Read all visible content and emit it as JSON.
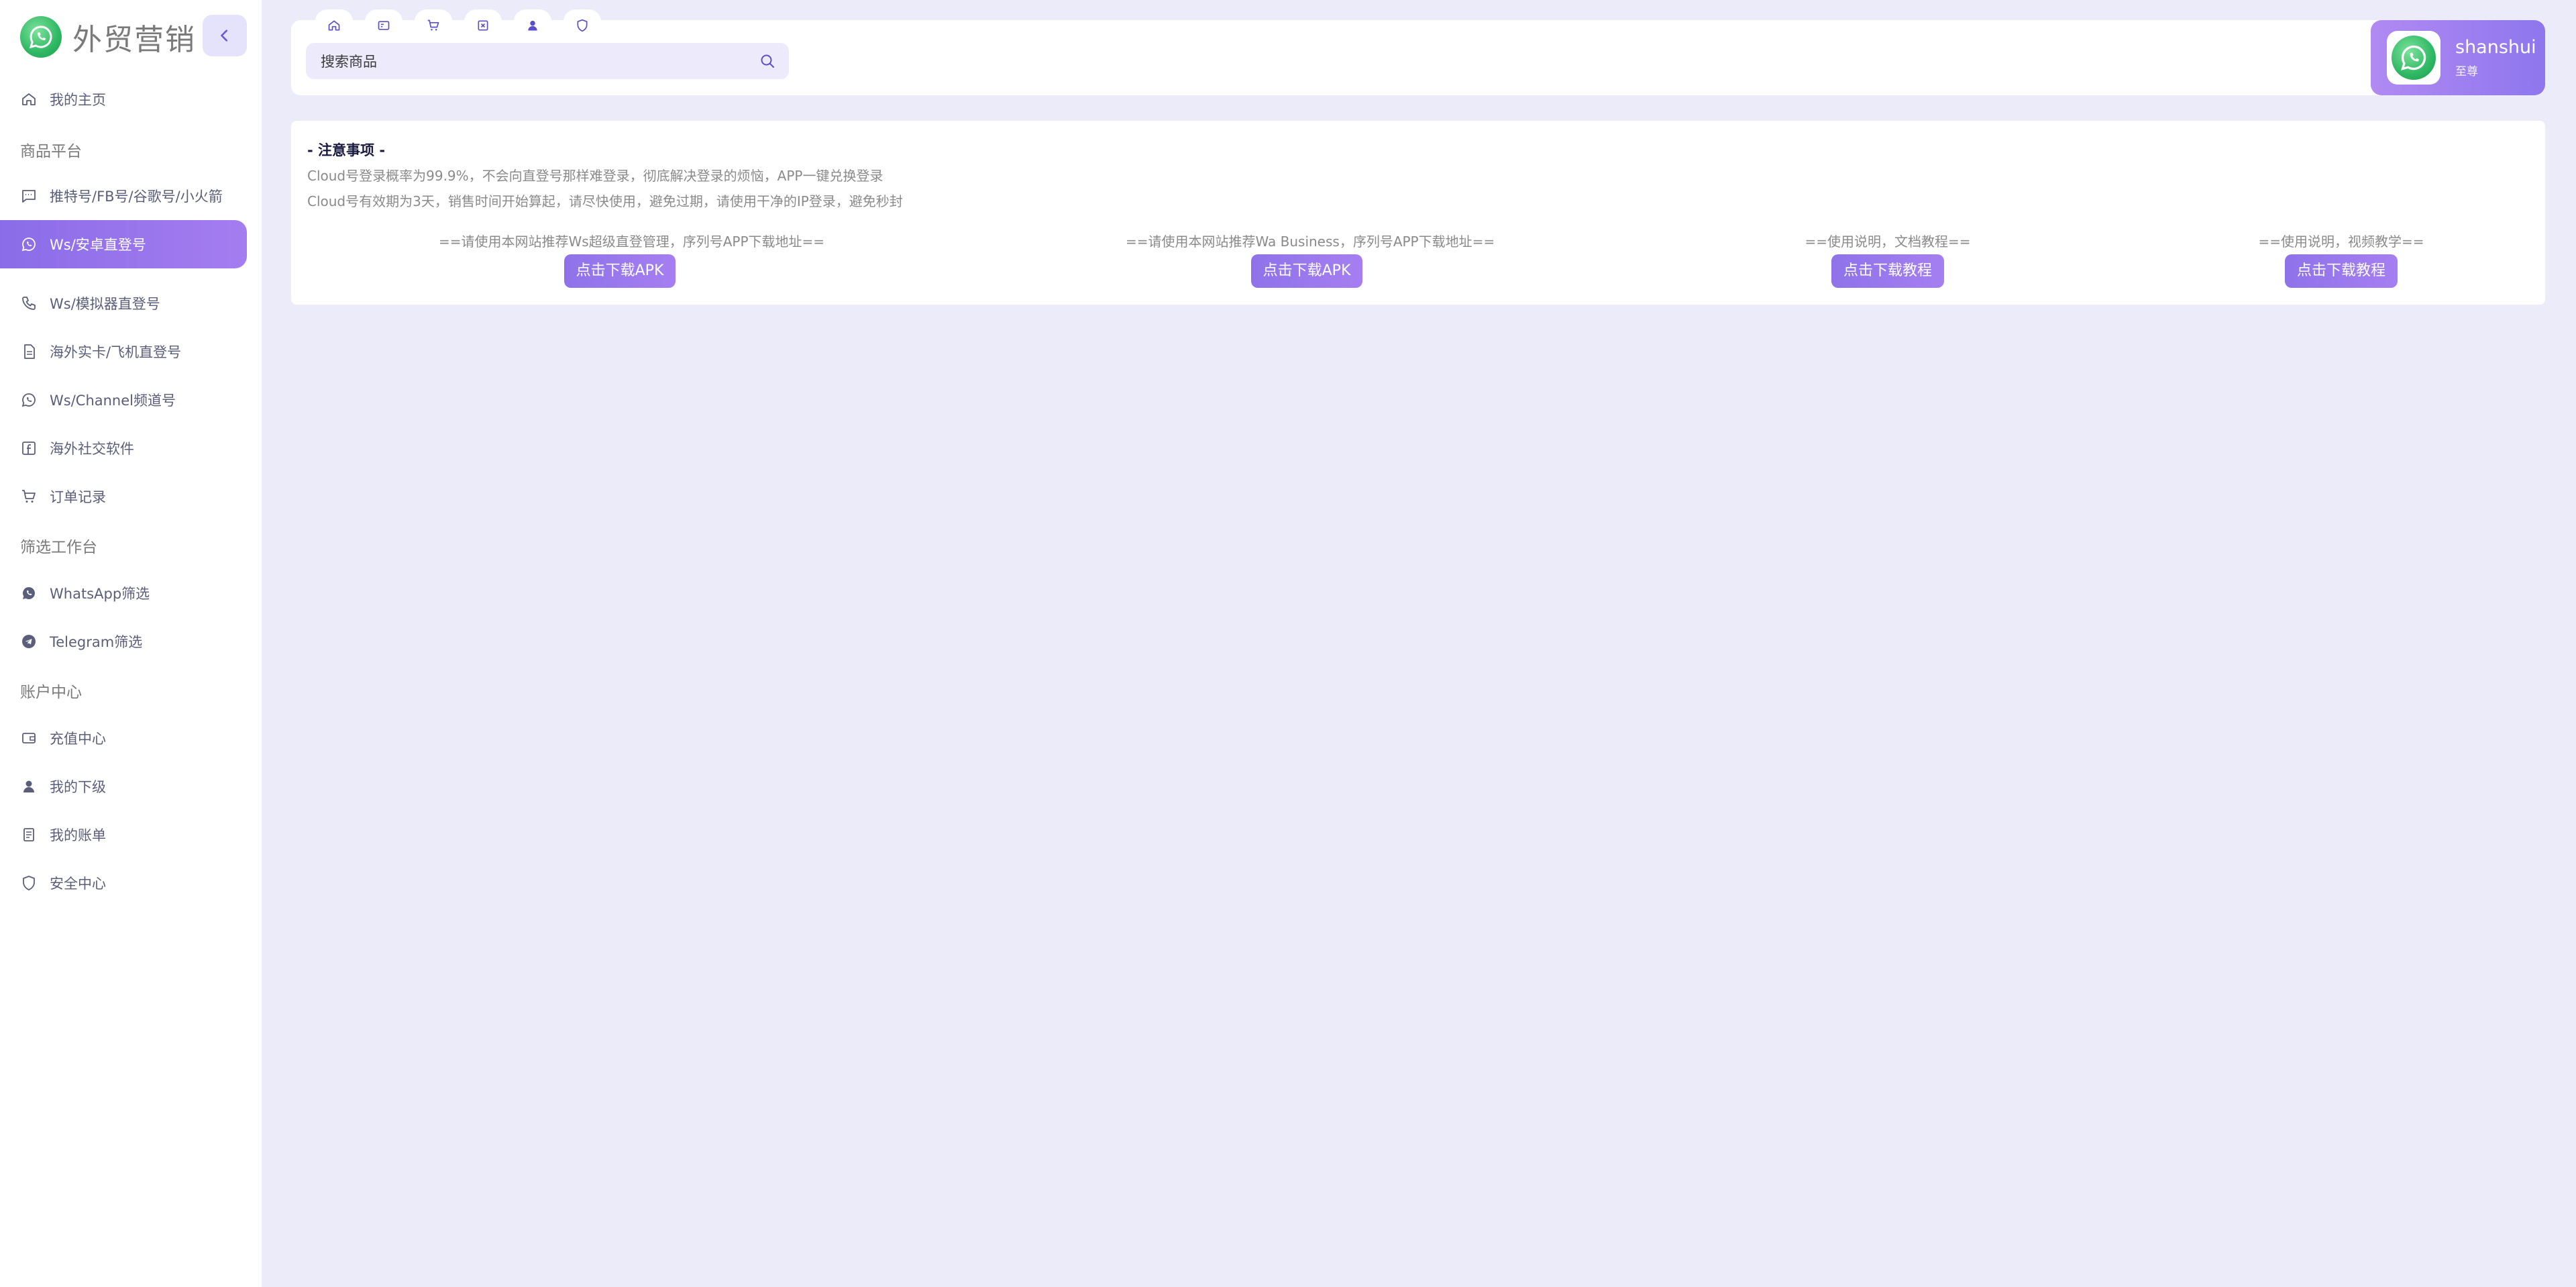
{
  "brand": {
    "title": "外贸营销"
  },
  "sidebar": {
    "items": [
      {
        "label": "我的主页",
        "icon": "home-icon"
      },
      {
        "group": "商品平台"
      },
      {
        "label": "推特号/FB号/谷歌号/小火箭",
        "icon": "message-icon"
      },
      {
        "label": "Ws/安卓直登号",
        "icon": "whatsapp-icon",
        "active": true
      },
      {
        "label": "Ws/模拟器直登号",
        "icon": "phone-icon"
      },
      {
        "label": "海外实卡/飞机直登号",
        "icon": "document-icon"
      },
      {
        "label": "Ws/Channel频道号",
        "icon": "whatsapp-icon"
      },
      {
        "label": "海外社交软件",
        "icon": "facebook-icon"
      },
      {
        "label": "订单记录",
        "icon": "cart-icon"
      },
      {
        "group": "筛选工作台"
      },
      {
        "label": "WhatsApp筛选",
        "icon": "whatsapp-icon"
      },
      {
        "label": "Telegram筛选",
        "icon": "telegram-icon"
      },
      {
        "group": "账户中心"
      },
      {
        "label": "充值中心",
        "icon": "wallet-icon"
      },
      {
        "label": "我的下级",
        "icon": "user-icon"
      },
      {
        "label": "我的账单",
        "icon": "bill-icon"
      },
      {
        "label": "安全中心",
        "icon": "shield-icon"
      }
    ]
  },
  "search": {
    "placeholder": "搜索商品"
  },
  "user": {
    "name": "shanshui",
    "level": "至尊"
  },
  "notice": {
    "title": "- 注意事项 -",
    "lines": [
      "Cloud号登录概率为99.9%，不会向直登号那样难登录，彻底解决登录的烦恼，APP一键兑换登录",
      "Cloud号有效期为3天，销售时间开始算起，请尽快使用，避免过期，请使用干净的IP登录，避免秒封"
    ],
    "downloads": [
      {
        "desc": "==请使用本网站推荐Ws超级直登管理，序列号APP下载地址==",
        "button": "点击下载APK"
      },
      {
        "desc": "==请使用本网站推荐Wa Business，序列号APP下载地址==",
        "button": "点击下载APK"
      },
      {
        "desc": "==使用说明，文档教程==",
        "button": "点击下载教程"
      },
      {
        "desc": "==使用说明，视频教学==",
        "button": "点击下载教程"
      }
    ]
  },
  "colors": {
    "accent": "#8b6ce8",
    "background": "#ecebfa",
    "sidebar": "#ffffff"
  }
}
